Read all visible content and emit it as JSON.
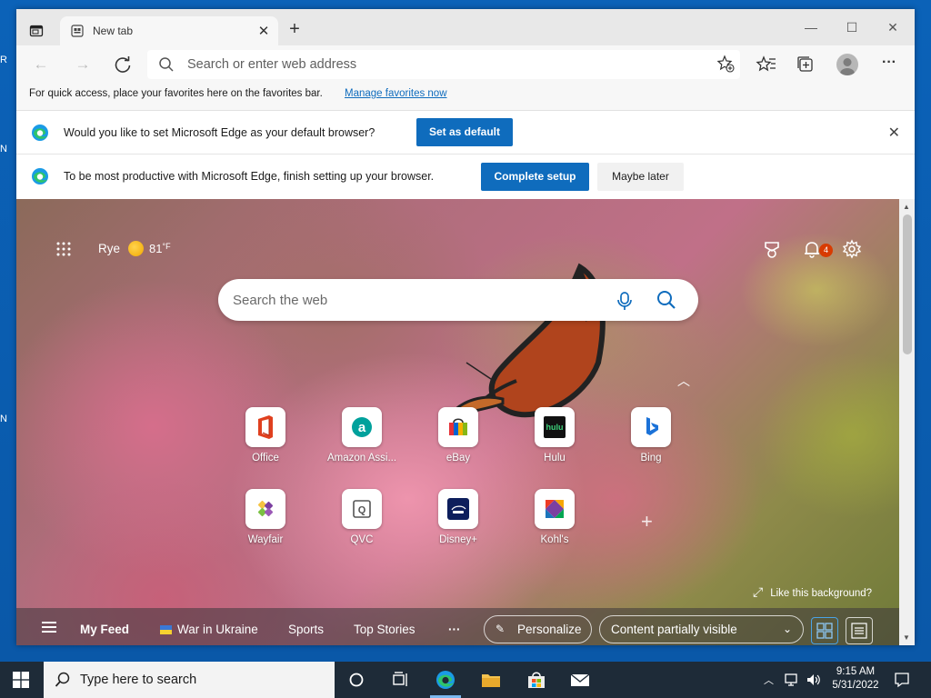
{
  "browser": {
    "tab_title": "New tab",
    "address_placeholder": "Search or enter web address"
  },
  "favorites_bar": {
    "message": "For quick access, place your favorites here on the favorites bar.",
    "link": "Manage favorites now"
  },
  "infobars": {
    "default_prompt": "Would you like to set Microsoft Edge as your default browser?",
    "default_button": "Set as default",
    "setup_prompt": "To be most productive with Microsoft Edge, finish setting up your browser.",
    "setup_button": "Complete setup",
    "later_button": "Maybe later"
  },
  "newtab": {
    "weather_city": "Rye",
    "weather_temp": "81",
    "weather_unit": "°F",
    "notifications_count": "4",
    "search_placeholder": "Search the web",
    "tiles": [
      {
        "label": "Office",
        "icon": "office-icon"
      },
      {
        "label": "Amazon Assi...",
        "icon": "amazon-icon"
      },
      {
        "label": "eBay",
        "icon": "ebay-icon"
      },
      {
        "label": "Hulu",
        "icon": "hulu-icon"
      },
      {
        "label": "Bing",
        "icon": "bing-icon"
      },
      {
        "label": "Wayfair",
        "icon": "wayfair-icon"
      },
      {
        "label": "QVC",
        "icon": "qvc-icon"
      },
      {
        "label": "Disney+",
        "icon": "disney-icon"
      },
      {
        "label": "Kohl's",
        "icon": "kohls-icon"
      }
    ],
    "like_background": "Like this background?",
    "feed": {
      "my_feed": "My Feed",
      "war": "War in Ukraine",
      "sports": "Sports",
      "top_stories": "Top Stories",
      "more": "···",
      "personalize": "Personalize",
      "content_visibility": "Content partially visible"
    }
  },
  "taskbar": {
    "search_placeholder": "Type here to search",
    "time": "9:15 AM",
    "date": "5/31/2022"
  },
  "colors": {
    "accent": "#0f6cbd",
    "desktop": "#0a5fb0",
    "taskbar": "#1e2b38"
  }
}
